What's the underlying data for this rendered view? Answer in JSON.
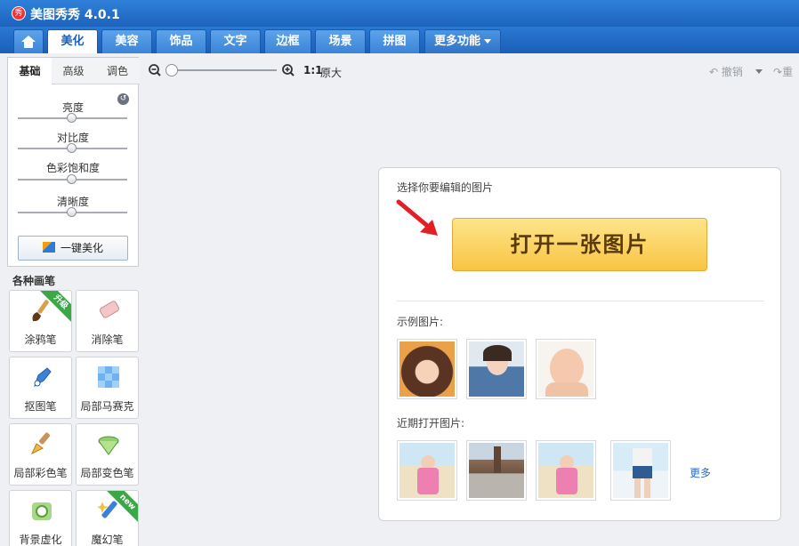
{
  "app": {
    "logo_text": "秀",
    "title": "美图秀秀 4.0.1"
  },
  "menu": {
    "home": "home",
    "tabs": [
      "美化",
      "美容",
      "饰品",
      "文字",
      "边框",
      "场景",
      "拼图"
    ],
    "more": "更多功能"
  },
  "left": {
    "subtabs": [
      "基础",
      "高级",
      "调色"
    ],
    "sliders": [
      {
        "label": "亮度",
        "level": 0.5
      },
      {
        "label": "对比度",
        "level": 0.5
      },
      {
        "label": "色彩饱和度",
        "level": 0.5
      },
      {
        "label": "清晰度",
        "level": 0.5
      }
    ],
    "onekey": "一键美化",
    "brush_title": "各种画笔",
    "brushes": [
      {
        "label": "涂鸦笔",
        "badge": "升级",
        "icon": "brush-icon"
      },
      {
        "label": "消除笔",
        "badge": "",
        "icon": "eraser-icon"
      },
      {
        "label": "抠图笔",
        "badge": "",
        "icon": "cutout-pen-icon"
      },
      {
        "label": "局部马赛克",
        "badge": "",
        "icon": "mosaic-icon"
      },
      {
        "label": "局部彩色笔",
        "badge": "",
        "icon": "color-brush-icon"
      },
      {
        "label": "局部变色笔",
        "badge": "",
        "icon": "recolor-icon"
      },
      {
        "label": "背景虚化",
        "badge": "",
        "icon": "blur-background-icon"
      },
      {
        "label": "魔幻笔",
        "badge": "new",
        "icon": "magic-pen-icon"
      }
    ]
  },
  "toolbar": {
    "ratio": "1:1",
    "original": "原大",
    "undo": "撤销",
    "redo": "重"
  },
  "main": {
    "choose_label": "选择你要编辑的图片",
    "open_button": "打开一张图片",
    "sample_label": "示例图片:",
    "recent_label": "近期打开图片:",
    "more": "更多"
  },
  "colors": {
    "accent": "#1c63bd",
    "button": "#f9c443",
    "arrow": "#e41e26"
  }
}
